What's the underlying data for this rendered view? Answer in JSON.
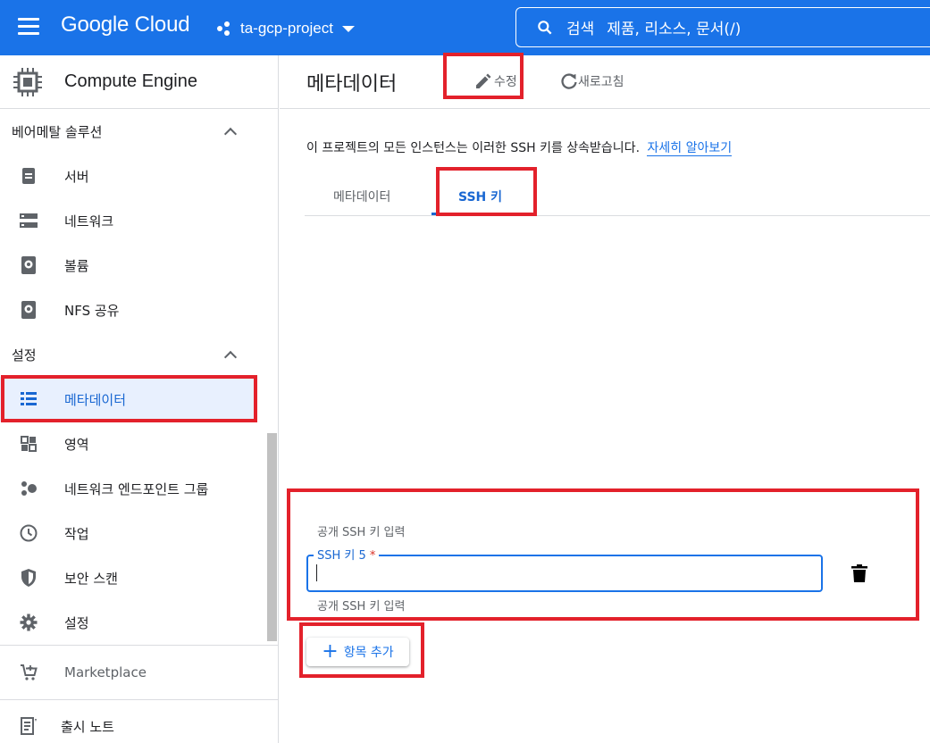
{
  "topbar": {
    "logo": "Google Cloud",
    "project": "ta-gcp-project",
    "search_label": "검색",
    "search_hint": "제품, 리소스, 문서(/)"
  },
  "sidebar": {
    "product": "Compute Engine",
    "sections": [
      {
        "label": "베어메탈 솔루션"
      },
      {
        "label": "설정"
      }
    ],
    "bare_metal_items": [
      {
        "label": "서버",
        "icon": "server-icon"
      },
      {
        "label": "네트워크",
        "icon": "network-icon"
      },
      {
        "label": "볼륨",
        "icon": "volume-icon"
      },
      {
        "label": "NFS 공유",
        "icon": "nfs-icon"
      }
    ],
    "settings_items": [
      {
        "label": "메타데이터",
        "icon": "metadata-icon",
        "active": true
      },
      {
        "label": "영역",
        "icon": "zones-icon"
      },
      {
        "label": "네트워크 엔드포인트 그룹",
        "icon": "endpoint-group-icon"
      },
      {
        "label": "작업",
        "icon": "operations-icon"
      },
      {
        "label": "보안 스캔",
        "icon": "shield-icon"
      },
      {
        "label": "설정",
        "icon": "gear-icon"
      }
    ],
    "footer_items": [
      {
        "label": "Marketplace",
        "icon": "cart-icon"
      },
      {
        "label": "출시 노트",
        "icon": "release-notes-icon"
      }
    ]
  },
  "main": {
    "title": "메타데이터",
    "edit_label": "수정",
    "refresh_label": "새로고침",
    "description": "이 프로젝트의 모든 인스턴스는 이러한 SSH 키를 상속받습니다.",
    "learn_more": "자세히 알아보기",
    "tabs": [
      {
        "label": "메타데이터"
      },
      {
        "label": "SSH 키",
        "active": true
      }
    ],
    "ssh_field": {
      "top_hint": "공개 SSH 키 입력",
      "label": "SSH 키 5",
      "required_mark": "*",
      "value": "",
      "bottom_hint": "공개 SSH 키 입력"
    },
    "add_item_label": "항목 추가"
  },
  "colors": {
    "brand_blue": "#1a73e8",
    "active_blue": "#1967d2",
    "highlight_red": "#e3212b"
  }
}
